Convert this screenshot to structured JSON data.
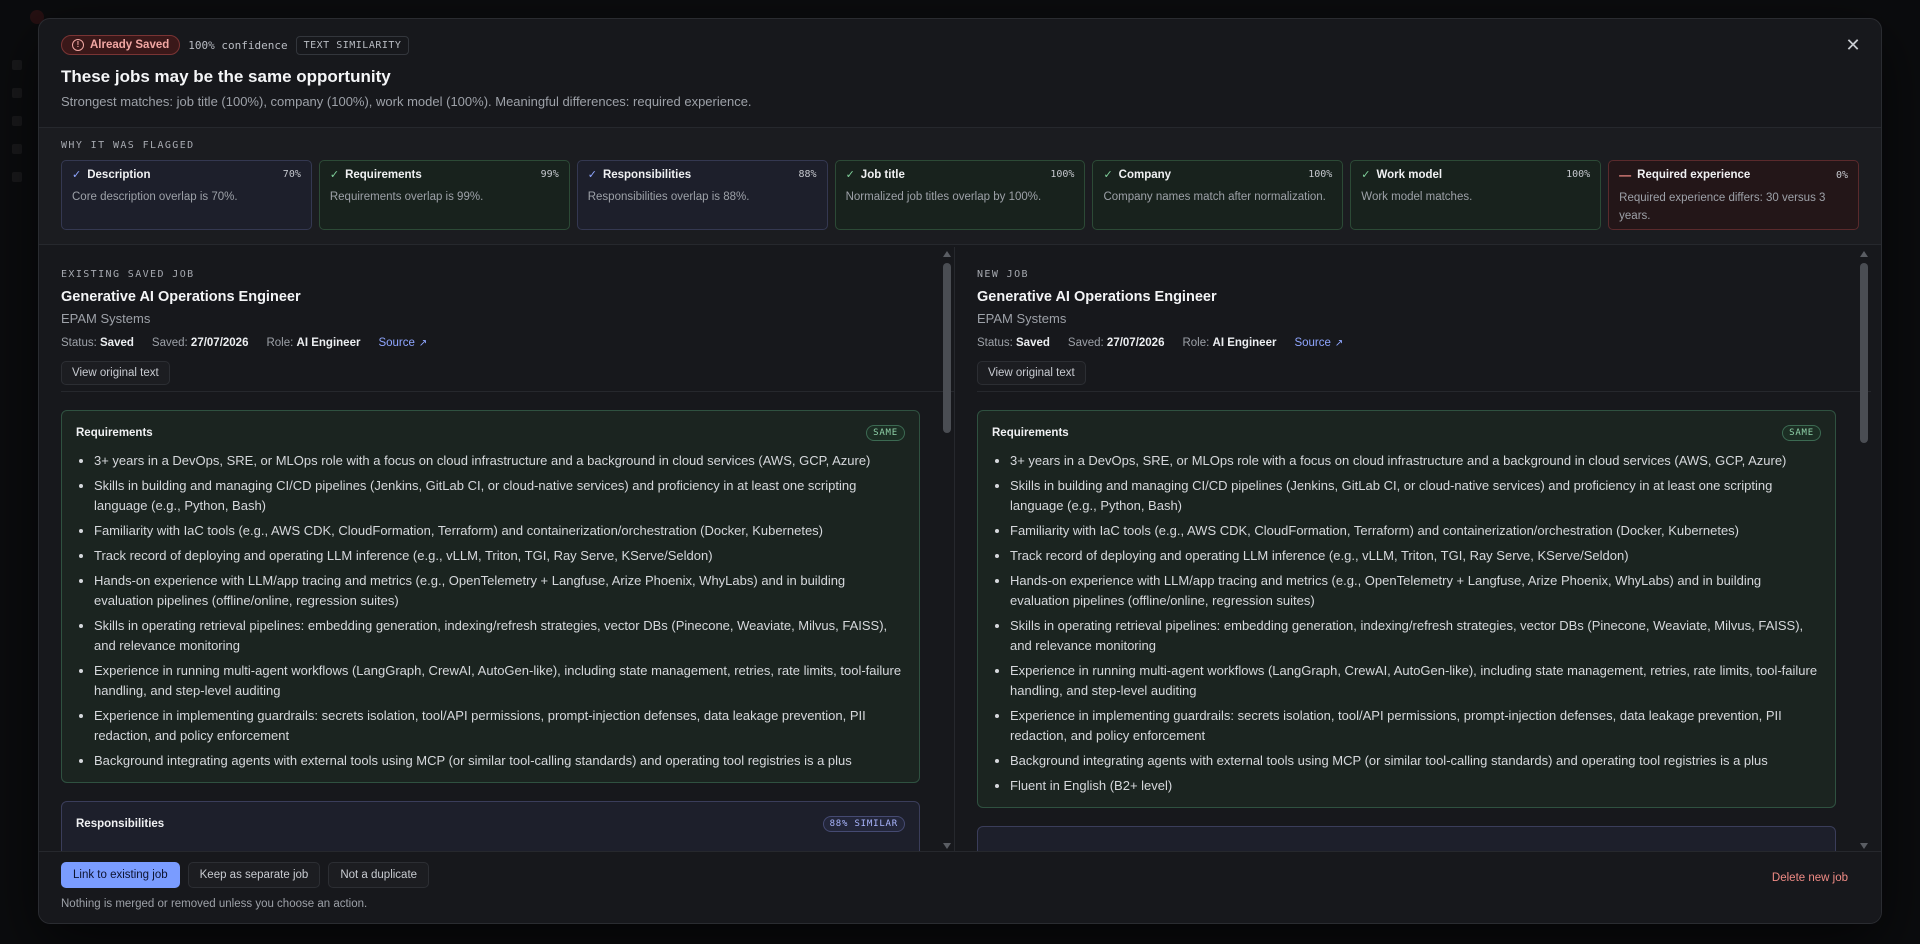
{
  "badge": {
    "label": "Already Saved"
  },
  "confidence": "100% confidence",
  "method_tag": "TEXT SIMILARITY",
  "title": "These jobs may be the same opportunity",
  "subtitle": "Strongest matches: job title (100%), company (100%), work model (100%). Meaningful differences: required experience.",
  "flagged": {
    "heading": "WHY IT WAS FLAGGED",
    "cards": [
      {
        "name": "Description",
        "pct": "70%",
        "desc": "Core description overlap is 70%."
      },
      {
        "name": "Requirements",
        "pct": "99%",
        "desc": "Requirements overlap is 99%."
      },
      {
        "name": "Responsibilities",
        "pct": "88%",
        "desc": "Responsibilities overlap is 88%."
      },
      {
        "name": "Job title",
        "pct": "100%",
        "desc": "Normalized job titles overlap by 100%."
      },
      {
        "name": "Company",
        "pct": "100%",
        "desc": "Company names match after normalization."
      },
      {
        "name": "Work model",
        "pct": "100%",
        "desc": "Work model matches."
      },
      {
        "name": "Required experience",
        "pct": "0%",
        "desc": "Required experience differs: 30 versus 3 years."
      }
    ]
  },
  "existing": {
    "label": "EXISTING SAVED JOB",
    "title": "Generative AI Operations Engineer",
    "company": "EPAM Systems",
    "status_label": "Status:",
    "status": "Saved",
    "saved_label": "Saved:",
    "saved": "27/07/2026",
    "role_label": "Role:",
    "role": "AI Engineer",
    "source": "Source",
    "view_btn": "View original text",
    "req_title": "Requirements",
    "req_badge": "SAME",
    "requirements": [
      "3+ years in a DevOps, SRE, or MLOps role with a focus on cloud infrastructure and a background in cloud services (AWS, GCP, Azure)",
      "Skills in building and managing CI/CD pipelines (Jenkins, GitLab CI, or cloud-native services) and proficiency in at least one scripting language (e.g., Python, Bash)",
      "Familiarity with IaC tools (e.g., AWS CDK, CloudFormation, Terraform) and containerization/orchestration (Docker, Kubernetes)",
      "Track record of deploying and operating LLM inference (e.g., vLLM, Triton, TGI, Ray Serve, KServe/Seldon)",
      "Hands-on experience with LLM/app tracing and metrics (e.g., OpenTelemetry + Langfuse, Arize Phoenix, WhyLabs) and in building evaluation pipelines (offline/online, regression suites)",
      "Skills in operating retrieval pipelines: embedding generation, indexing/refresh strategies, vector DBs (Pinecone, Weaviate, Milvus, FAISS), and relevance monitoring",
      "Experience in running multi-agent workflows (LangGraph, CrewAI, AutoGen-like), including state management, retries, rate limits, tool-failure handling, and step-level auditing",
      "Experience in implementing guardrails: secrets isolation, tool/API permissions, prompt-injection defenses, data leakage prevention, PII redaction, and policy enforcement",
      "Background integrating agents with external tools using MCP (or similar tool-calling standards) and operating tool registries is a plus"
    ],
    "resp_title": "Responsibilities",
    "resp_badge": "88% SIMILAR"
  },
  "new_job": {
    "label": "NEW JOB",
    "title": "Generative AI Operations Engineer",
    "company": "EPAM Systems",
    "status_label": "Status:",
    "status": "Saved",
    "saved_label": "Saved:",
    "saved": "27/07/2026",
    "role_label": "Role:",
    "role": "AI Engineer",
    "source": "Source",
    "view_btn": "View original text",
    "req_title": "Requirements",
    "req_badge": "SAME",
    "requirements": [
      "3+ years in a DevOps, SRE, or MLOps role with a focus on cloud infrastructure and a background in cloud services (AWS, GCP, Azure)",
      "Skills in building and managing CI/CD pipelines (Jenkins, GitLab CI, or cloud-native services) and proficiency in at least one scripting language (e.g., Python, Bash)",
      "Familiarity with IaC tools (e.g., AWS CDK, CloudFormation, Terraform) and containerization/orchestration (Docker, Kubernetes)",
      "Track record of deploying and operating LLM inference (e.g., vLLM, Triton, TGI, Ray Serve, KServe/Seldon)",
      "Hands-on experience with LLM/app tracing and metrics (e.g., OpenTelemetry + Langfuse, Arize Phoenix, WhyLabs) and in building evaluation pipelines (offline/online, regression suites)",
      "Skills in operating retrieval pipelines: embedding generation, indexing/refresh strategies, vector DBs (Pinecone, Weaviate, Milvus, FAISS), and relevance monitoring",
      "Experience in running multi-agent workflows (LangGraph, CrewAI, AutoGen-like), including state management, retries, rate limits, tool-failure handling, and step-level auditing",
      "Experience in implementing guardrails: secrets isolation, tool/API permissions, prompt-injection defenses, data leakage prevention, PII redaction, and policy enforcement",
      "Background integrating agents with external tools using MCP (or similar tool-calling standards) and operating tool registries is a plus",
      "Fluent in English (B2+ level)"
    ]
  },
  "footer": {
    "link_btn": "Link to existing job",
    "separate_btn": "Keep as separate job",
    "not_dup_btn": "Not a duplicate",
    "delete_btn": "Delete new job",
    "note": "Nothing is merged or removed unless you choose an action."
  }
}
